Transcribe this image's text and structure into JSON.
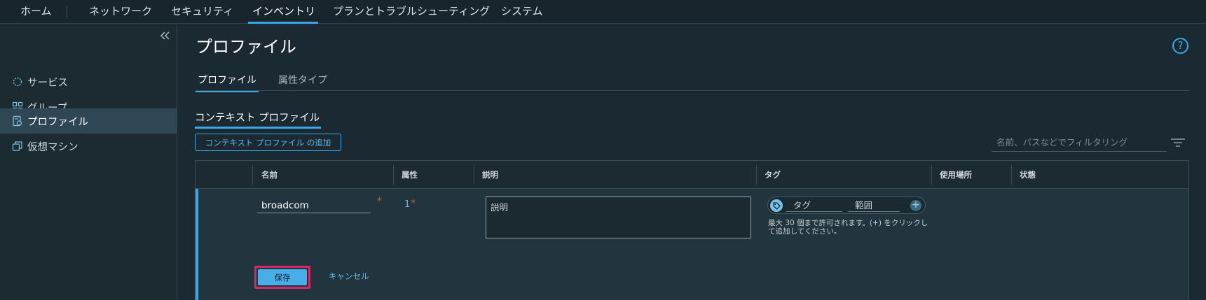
{
  "topnav": {
    "items": [
      "ホーム",
      "ネットワーク",
      "セキュリティ",
      "インベントリ",
      "プランとトラブルシューティング",
      "システム"
    ],
    "active": "インベントリ"
  },
  "sidebar": {
    "items": [
      {
        "label": "サービス",
        "icon": "service-icon"
      },
      {
        "label": "グループ",
        "icon": "group-icon"
      },
      {
        "label": "プロファイル",
        "icon": "profile-icon",
        "active": true
      },
      {
        "label": "仮想マシン",
        "icon": "virtual-machine-icon"
      }
    ]
  },
  "main": {
    "title": "プロファイル",
    "tabs": [
      {
        "label": "プロファイル",
        "active": true
      },
      {
        "label": "属性タイプ",
        "active": false
      }
    ],
    "section_title": "コンテキスト プロファイル",
    "add_button": "コンテキスト プロファイル の追加",
    "filter_placeholder": "名前、パスなどでフィルタリング"
  },
  "table": {
    "columns": [
      "名前",
      "属性",
      "説明",
      "タグ",
      "使用場所",
      "状態"
    ],
    "edit_row": {
      "name_value": "broadcom",
      "required_mark": "*",
      "attribute_count": "1",
      "description_placeholder": "説明",
      "tag_placeholder": "タグ",
      "scope_placeholder": "範囲",
      "tag_add_symbol": "+",
      "tag_hint": "最大 30 個まで許可されます。(+) をクリックして追加してください。",
      "save_label": "保存",
      "cancel_label": "キャンセル"
    }
  },
  "colors": {
    "accent": "#3ba7e4",
    "required": "#e5483f",
    "highlight": "#d8286a",
    "background": "#1b2a32"
  }
}
